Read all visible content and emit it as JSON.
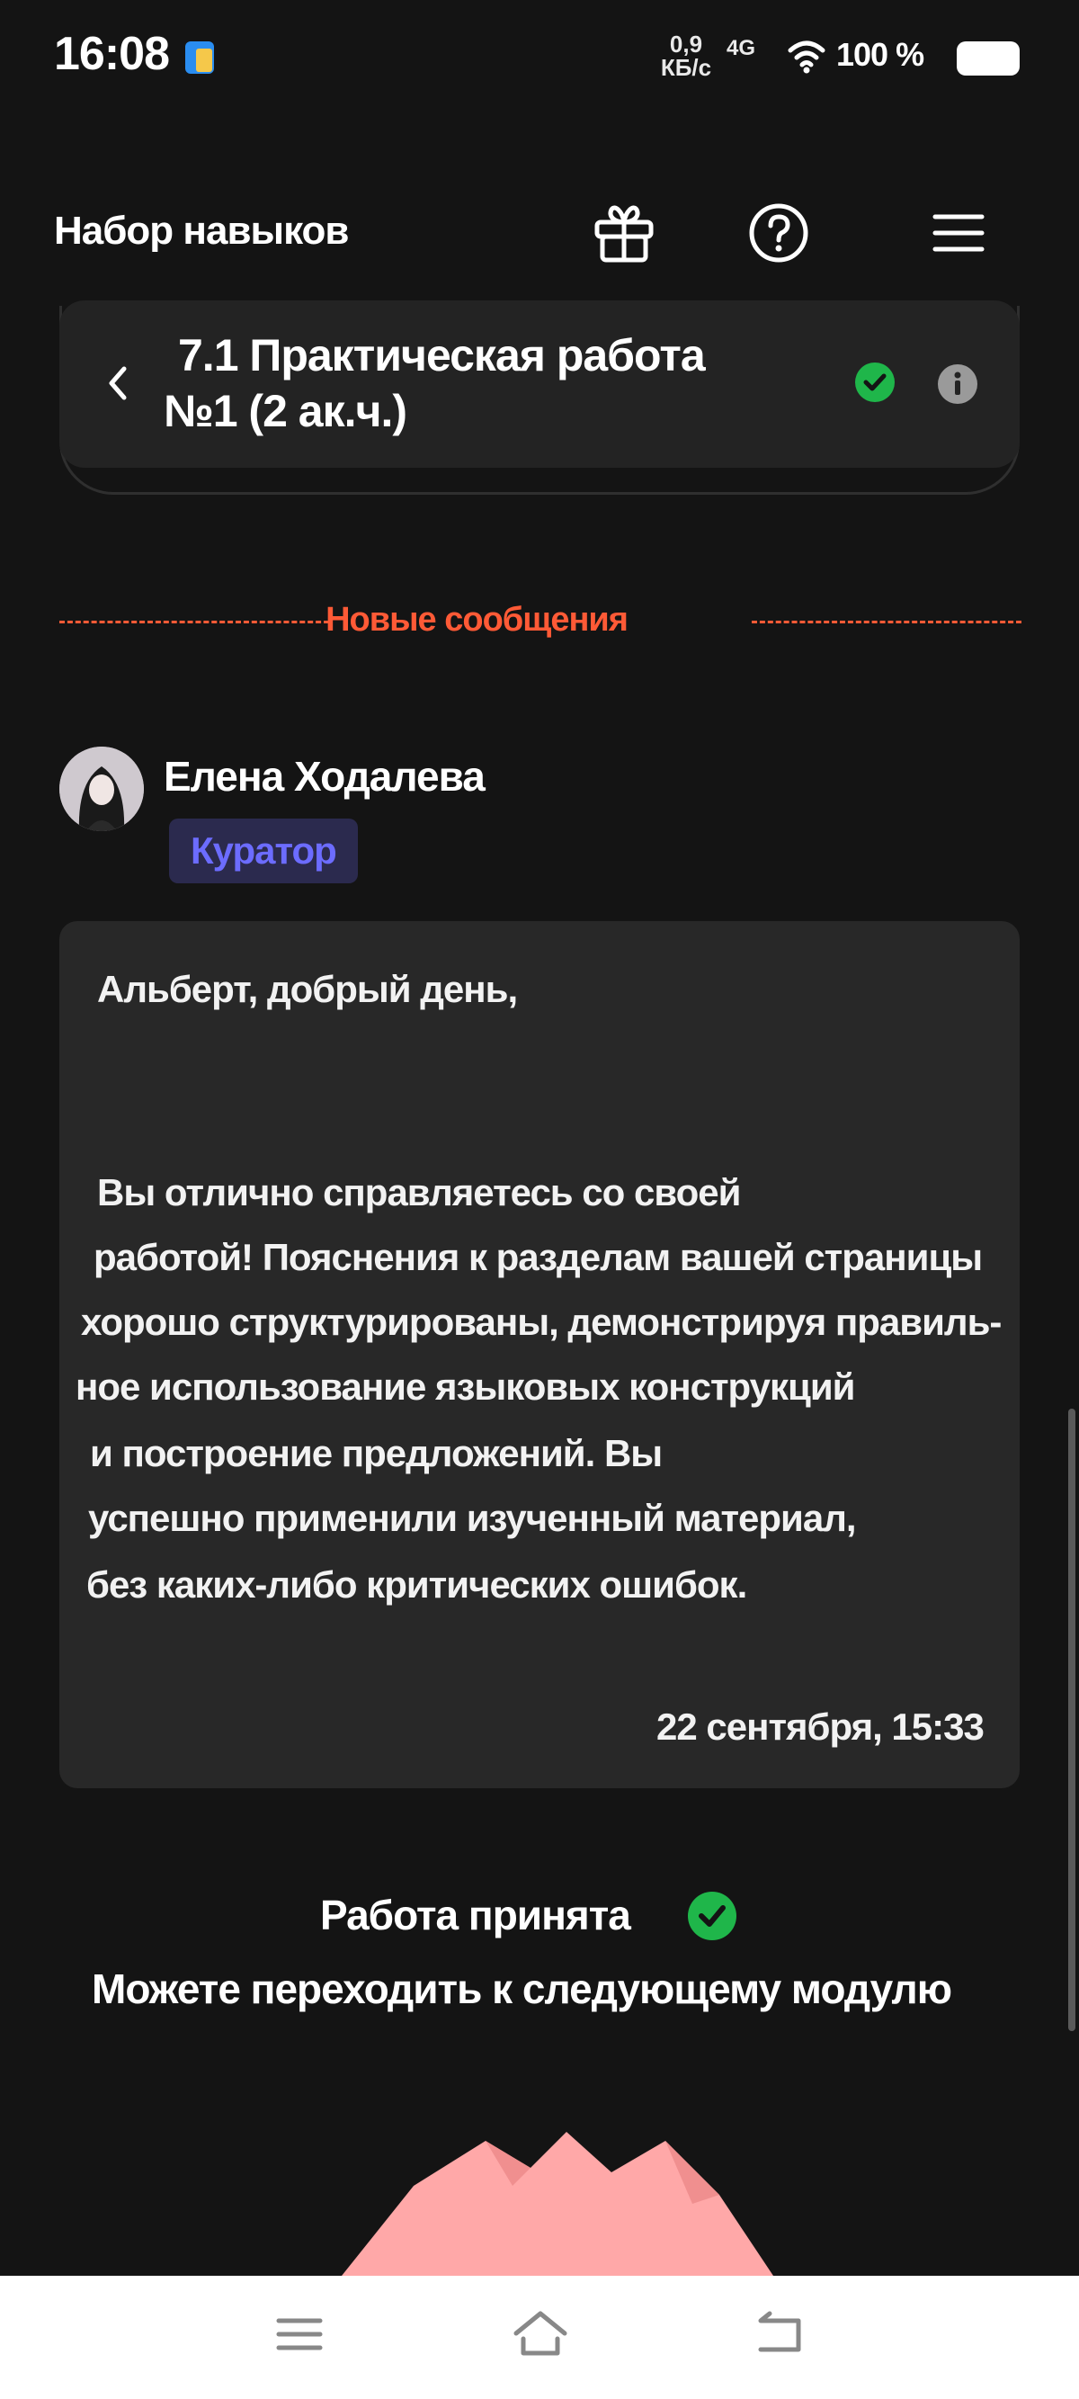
{
  "status_bar": {
    "time": "16:08",
    "speed_value": "0,9",
    "speed_unit": "КБ/с",
    "network": "4G",
    "battery": "100 %"
  },
  "header": {
    "title": "Набор навыков",
    "icons": [
      "gift-icon",
      "help-icon",
      "menu-icon"
    ]
  },
  "lesson": {
    "title_line1": "7.1 Практическая работа",
    "title_line2": "№1 (2 ак.ч.)",
    "status_color": "#1fb64a"
  },
  "divider": {
    "label": "Новые сообщения",
    "color": "#ff5a36"
  },
  "message": {
    "author": "Елена Ходалева",
    "role": "Куратор",
    "greeting": "Альберт, добрый день,",
    "lines": [
      "Вы отлично справляетесь со своей",
      "работой! Пояснения к разделам вашей страницы",
      "хорошо структурированы, демонстрируя правиль-",
      "ное использование языковых конструкций",
      "и построение предложений. Вы",
      "успешно применили изученный материал,",
      "без каких-либо критических ошибок."
    ],
    "timestamp": "22 сентября, 15:33"
  },
  "result": {
    "status": "Работа принята",
    "next": "Можете переходить к следующему модулю"
  },
  "navbar": {
    "icons": [
      "nav-menu-icon",
      "nav-home-icon",
      "nav-back-icon"
    ]
  }
}
